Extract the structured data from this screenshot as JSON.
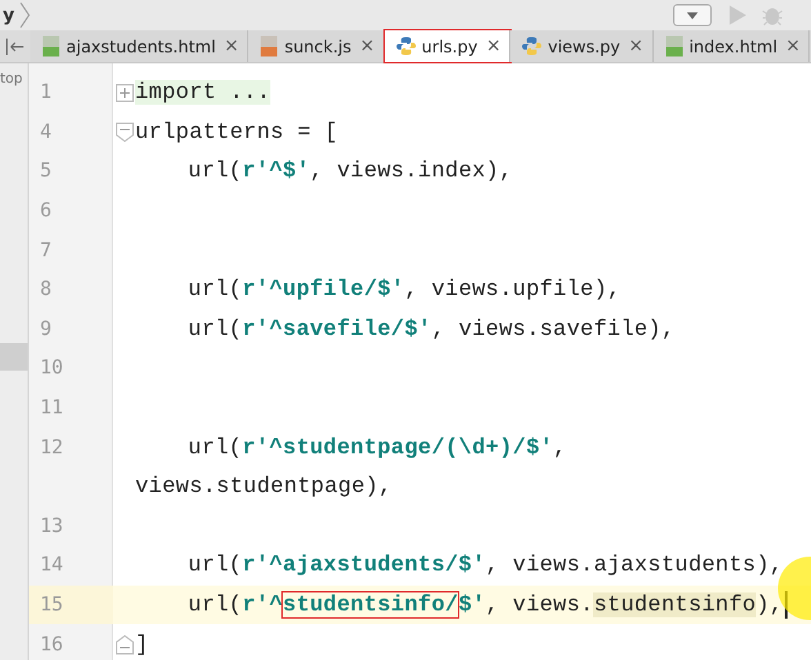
{
  "breadcrumb": "y",
  "side_panel": {
    "label": "top"
  },
  "tabs": [
    {
      "label": "ajaxstudents.html",
      "kind": "html",
      "selected": false,
      "marked": false
    },
    {
      "label": "sunck.js",
      "kind": "js",
      "selected": false,
      "marked": false
    },
    {
      "label": "urls.py",
      "kind": "py",
      "selected": true,
      "marked": true
    },
    {
      "label": "views.py",
      "kind": "py",
      "selected": false,
      "marked": false
    },
    {
      "label": "index.html",
      "kind": "html",
      "selected": false,
      "marked": false
    }
  ],
  "tab_close": "×",
  "lines": [
    {
      "number": "1",
      "kind": "collapsed",
      "current": false,
      "indented": false,
      "tokens": [
        {
          "text": "import ...",
          "kind": "folded"
        }
      ]
    },
    {
      "number": "4",
      "kind": "opener",
      "current": false,
      "indented": false,
      "tokens": [
        {
          "text": "urlpatterns = [",
          "kind": "plain"
        }
      ]
    },
    {
      "number": "5",
      "kind": "code",
      "current": false,
      "indented": true,
      "tokens": [
        {
          "text": "url(",
          "kind": "plain"
        },
        {
          "text": "r'^$'",
          "kind": "string"
        },
        {
          "text": ", views.index),",
          "kind": "plain"
        }
      ]
    },
    {
      "number": "6",
      "kind": "code",
      "current": false
    },
    {
      "number": "7",
      "kind": "code",
      "current": false
    },
    {
      "number": "8",
      "kind": "code",
      "current": false,
      "indented": true,
      "tokens": [
        {
          "text": "url(",
          "kind": "plain"
        },
        {
          "text": "r'^upfile/$'",
          "kind": "string"
        },
        {
          "text": ", views.upfile),",
          "kind": "plain"
        }
      ]
    },
    {
      "number": "9",
      "kind": "code",
      "current": false,
      "indented": true,
      "tokens": [
        {
          "text": "url(",
          "kind": "plain"
        },
        {
          "text": "r'^savefile/$'",
          "kind": "string"
        },
        {
          "text": ", views.savefile),",
          "kind": "plain"
        }
      ]
    },
    {
      "number": "10",
      "kind": "code",
      "current": false
    },
    {
      "number": "11",
      "kind": "code",
      "current": false
    },
    {
      "number": "12",
      "kind": "code",
      "current": false,
      "indented": true,
      "tokens": [
        {
          "text": "url(",
          "kind": "plain"
        },
        {
          "text": "r'^studentpage/(\\d+)/$'",
          "kind": "string"
        },
        {
          "text": ",",
          "kind": "plain"
        }
      ],
      "continuation": "views.studentpage),"
    },
    {
      "number": "13",
      "kind": "code",
      "current": false
    },
    {
      "number": "14",
      "kind": "code",
      "current": false,
      "indented": true,
      "tokens": [
        {
          "text": "url(",
          "kind": "plain"
        },
        {
          "text": "r'^ajaxstudents/$'",
          "kind": "string"
        },
        {
          "text": ", views.ajaxstudents),",
          "kind": "plain"
        }
      ]
    },
    {
      "number": "15",
      "kind": "code",
      "current": true,
      "indented": true,
      "tokens": [
        {
          "text": "url(",
          "kind": "plain"
        },
        {
          "text": "r'^",
          "kind": "string"
        },
        {
          "text": "studentsinfo/",
          "kind": "boxed"
        },
        {
          "text": "$'",
          "kind": "string"
        },
        {
          "text": ", views.",
          "kind": "plain"
        },
        {
          "text": "studentsinfo",
          "kind": "highlight"
        },
        {
          "text": "),",
          "kind": "plain"
        }
      ]
    },
    {
      "number": "16",
      "kind": "closer",
      "current": false,
      "indented": false,
      "tokens": [
        {
          "text": "]",
          "kind": "plain"
        }
      ]
    }
  ]
}
